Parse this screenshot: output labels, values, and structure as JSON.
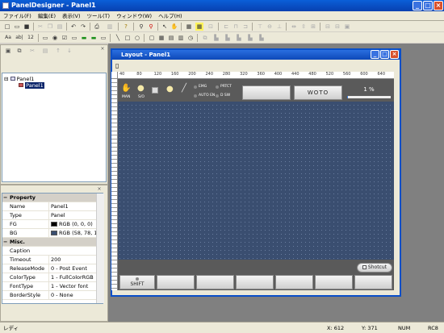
{
  "app": {
    "title": "PanelDesigner - Panel1"
  },
  "menu": [
    "ファイル(F)",
    "編集(E)",
    "表示(V)",
    "ツール(T)",
    "ウィンドウ(W)",
    "ヘルプ(H)"
  ],
  "toolbar2": {
    "text_aa": "Aa",
    "text_ab": "ab|",
    "text_12": "12"
  },
  "tree": {
    "root": "Panel1",
    "child": "Panel1"
  },
  "properties": {
    "section1": "Property",
    "rows1": [
      {
        "name": "Name",
        "value": "Panel1"
      },
      {
        "name": "Type",
        "value": "Panel"
      },
      {
        "name": "FG",
        "value": "RGB (0, 0, 0)",
        "swatch": "#000000"
      },
      {
        "name": "BG",
        "value": "RGB (58, 78, 11",
        "swatch": "#3a4e70"
      }
    ],
    "section2": "Misc.",
    "rows2": [
      {
        "name": "Caption",
        "value": ""
      },
      {
        "name": "Timeout",
        "value": "200"
      },
      {
        "name": "ReleaseMode",
        "value": "0 - Post Event"
      },
      {
        "name": "ColorType",
        "value": "1 - FullColorRGB"
      },
      {
        "name": "FontType",
        "value": "1 - Vector font"
      },
      {
        "name": "BorderStyle",
        "value": "0 - None"
      }
    ]
  },
  "layout_window": {
    "title": "Layout - Panel1",
    "ruler_ticks": [
      "40",
      "80",
      "120",
      "160",
      "200",
      "240",
      "280",
      "320",
      "360",
      "400",
      "440",
      "480",
      "520",
      "560",
      "600",
      "640"
    ]
  },
  "panel": {
    "hand_label": "MAN",
    "so_label": "S/O",
    "lamps": [
      "EMG",
      "PRTCT",
      "AUTO EN",
      "D SW"
    ],
    "woto": "WOTO",
    "percent": "1 %",
    "shotcut": "Shotcut",
    "shift": "SHIFT"
  },
  "status": {
    "left": "レディ",
    "x": "X: 612",
    "y": "Y: 371",
    "num": "NUM",
    "rc": "RC8"
  },
  "colors": {
    "canvas": "#3a4e70",
    "titlebar": "#0a5fd8",
    "close": "#d9512c"
  }
}
